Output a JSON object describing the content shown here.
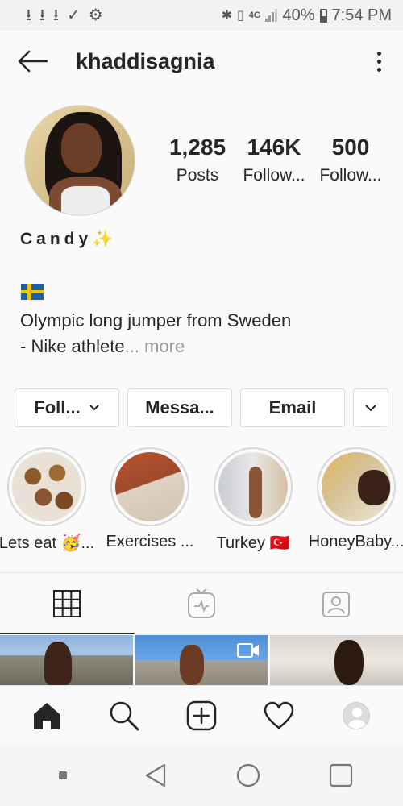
{
  "status_bar": {
    "network": "4G",
    "battery": "40%",
    "time": "7:54 PM"
  },
  "header": {
    "username": "khaddisagnia"
  },
  "profile": {
    "stats": [
      {
        "value": "1,285",
        "label": "Posts"
      },
      {
        "value": "146K",
        "label": "Follow..."
      },
      {
        "value": "500",
        "label": "Follow..."
      }
    ],
    "display_name": "Candy✨",
    "bio_flag": "sweden-flag-emoji",
    "bio_line1": "Olympic long jumper from Sweden",
    "bio_line2": " - Nike athlete",
    "bio_more": "... more"
  },
  "actions": {
    "follow": "Foll...",
    "message": "Messa...",
    "email": "Email"
  },
  "highlights": [
    {
      "label": "Lets eat 🥳..."
    },
    {
      "label": "Exercises ..."
    },
    {
      "label": "Turkey 🇹🇷"
    },
    {
      "label": "HoneyBaby..."
    }
  ],
  "tabs": [
    {
      "name": "grid-icon"
    },
    {
      "name": "igtv-icon"
    },
    {
      "name": "tagged-icon"
    }
  ],
  "bottom_nav": [
    "home-icon",
    "search-icon",
    "add-post-icon",
    "activity-heart-icon",
    "profile-avatar"
  ],
  "colors": {
    "text": "#262626",
    "muted": "#999999",
    "border": "#dbdbdb",
    "background": "#fafafa"
  }
}
